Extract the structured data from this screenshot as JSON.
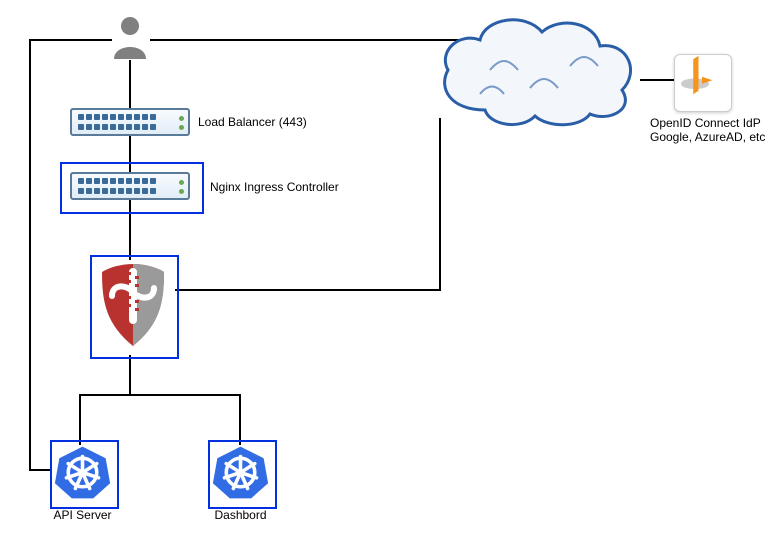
{
  "labels": {
    "load_balancer": "Load Balancer (443)",
    "nginx_ingress": "Nginx Ingress Controller",
    "api_server": "API Server",
    "dashboard": "Dashbord",
    "openid_idp_line1": "OpenID Connect IdP",
    "openid_idp_line2": "Google, AzureAD, etc"
  },
  "nodes": {
    "user": {
      "type": "user",
      "icon": "person-icon"
    },
    "load_balancer": {
      "type": "network-device",
      "icon": "switch-icon"
    },
    "nginx_ingress": {
      "type": "network-device",
      "boxed": true,
      "icon": "switch-icon"
    },
    "gatekeeper": {
      "type": "auth-proxy",
      "boxed": true,
      "icon": "shield-icon"
    },
    "api_server": {
      "type": "kubernetes",
      "boxed": true,
      "icon": "kubernetes-icon"
    },
    "dashboard": {
      "type": "kubernetes",
      "boxed": true,
      "icon": "kubernetes-icon"
    },
    "cloud": {
      "type": "internet",
      "icon": "cloud-icon"
    },
    "openid_idp": {
      "type": "idp",
      "icon": "openid-icon"
    }
  },
  "edges": [
    {
      "from": "user",
      "to": "cloud"
    },
    {
      "from": "cloud",
      "to": "openid_idp"
    },
    {
      "from": "user",
      "to": "load_balancer"
    },
    {
      "from": "load_balancer",
      "to": "nginx_ingress"
    },
    {
      "from": "nginx_ingress",
      "to": "gatekeeper"
    },
    {
      "from": "gatekeeper",
      "to": "cloud"
    },
    {
      "from": "gatekeeper",
      "to": "api_server"
    },
    {
      "from": "gatekeeper",
      "to": "dashboard"
    },
    {
      "from": "user",
      "to": "api_server"
    }
  ],
  "colors": {
    "edge": "#000000",
    "box_border": "#0030e0",
    "cloud_stroke": "#2a5ea6",
    "cloud_fill": "#f3f6fb",
    "k8s": "#326ce5",
    "shield_red": "#b8322f",
    "shield_grey": "#9a9a9a",
    "openid_orange": "#f7941e",
    "user": "#808080"
  }
}
